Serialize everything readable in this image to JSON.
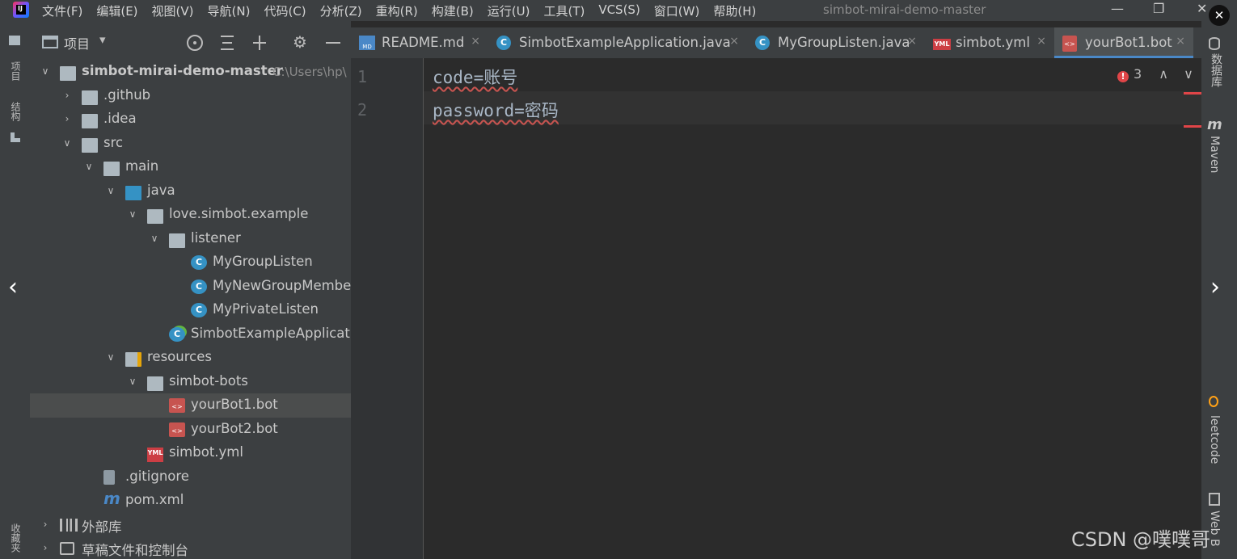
{
  "menubar": {
    "items": [
      "文件(F)",
      "编辑(E)",
      "视图(V)",
      "导航(N)",
      "代码(C)",
      "分析(Z)",
      "重构(R)",
      "构建(B)",
      "运行(U)",
      "工具(T)",
      "VCS(S)",
      "窗口(W)",
      "帮助(H)"
    ],
    "window_title": "simbot-mirai-demo-master",
    "minimize": "—",
    "restore": "❐",
    "close": "✕"
  },
  "left_strip": {
    "project_tab": "项目",
    "structure_tab": "结构",
    "favorites_tab": "收藏夹"
  },
  "project_panel": {
    "title": "项目",
    "dropdown": "▾",
    "toolbar_icons": [
      "locate-icon",
      "expand-all-icon",
      "collapse-all-icon",
      "gear-icon",
      "hide-icon"
    ],
    "tree": [
      {
        "level": 0,
        "arrow": "∨",
        "icon": "folder",
        "label": "simbot-mirai-demo-master",
        "hint": "C:\\Users\\hp\\"
      },
      {
        "level": 1,
        "arrow": "›",
        "icon": "folder",
        "label": ".github"
      },
      {
        "level": 1,
        "arrow": "›",
        "icon": "folder",
        "label": ".idea"
      },
      {
        "level": 1,
        "arrow": "∨",
        "icon": "folder",
        "label": "src"
      },
      {
        "level": 2,
        "arrow": "∨",
        "icon": "folder",
        "label": "main"
      },
      {
        "level": 3,
        "arrow": "∨",
        "icon": "folder-blue",
        "label": "java"
      },
      {
        "level": 4,
        "arrow": "∨",
        "icon": "package",
        "label": "love.simbot.example"
      },
      {
        "level": 5,
        "arrow": "∨",
        "icon": "package",
        "label": "listener"
      },
      {
        "level": 6,
        "arrow": "",
        "icon": "class",
        "label": "MyGroupListen"
      },
      {
        "level": 6,
        "arrow": "",
        "icon": "class",
        "label": "MyNewGroupMembe"
      },
      {
        "level": 6,
        "arrow": "",
        "icon": "class",
        "label": "MyPrivateListen"
      },
      {
        "level": 5,
        "arrow": "",
        "icon": "app-class",
        "label": "SimbotExampleApplicatio"
      },
      {
        "level": 3,
        "arrow": "∨",
        "icon": "resources",
        "label": "resources"
      },
      {
        "level": 4,
        "arrow": "∨",
        "icon": "folder",
        "label": "simbot-bots"
      },
      {
        "level": 5,
        "arrow": "",
        "icon": "bot",
        "label": "yourBot1.bot",
        "selected": true
      },
      {
        "level": 5,
        "arrow": "",
        "icon": "bot",
        "label": "yourBot2.bot"
      },
      {
        "level": 4,
        "arrow": "",
        "icon": "yml",
        "label": "simbot.yml"
      },
      {
        "level": 2,
        "arrow": "",
        "icon": "gitignore",
        "label": ".gitignore"
      },
      {
        "level": 2,
        "arrow": "",
        "icon": "maven",
        "label": "pom.xml"
      },
      {
        "level": 0,
        "arrow": "›",
        "icon": "library",
        "label": "外部库"
      },
      {
        "level": 0,
        "arrow": "›",
        "icon": "scratch",
        "label": "草稿文件和控制台"
      }
    ]
  },
  "editor": {
    "tabs": [
      {
        "label": "README.md",
        "icon": "md",
        "active": false
      },
      {
        "label": "SimbotExampleApplication.java",
        "icon": "app-class",
        "active": false
      },
      {
        "label": "MyGroupListen.java",
        "icon": "class",
        "active": false
      },
      {
        "label": "simbot.yml",
        "icon": "yml",
        "active": false
      },
      {
        "label": "yourBot1.bot",
        "icon": "bot",
        "active": true
      }
    ],
    "tab_close": "×",
    "line_numbers": [
      "1",
      "2"
    ],
    "lines": [
      "code=账号",
      "password=密码"
    ],
    "error_count": "3",
    "error_glyph": "!",
    "nav_up": "∧",
    "nav_down": "∨"
  },
  "right_strip": {
    "database_tab": "数据库",
    "maven_tab": "Maven",
    "leetcode_tab": "leetcode",
    "web_tab": "Web B"
  },
  "overlay": {
    "close": "✕",
    "prev": "‹",
    "next": "›",
    "watermark": "CSDN @噗噗哥"
  },
  "colors": {
    "accent": "#4a88c7",
    "error": "#e04548",
    "panel_bg": "#3c3f41",
    "editor_bg": "#2b2b2b"
  }
}
